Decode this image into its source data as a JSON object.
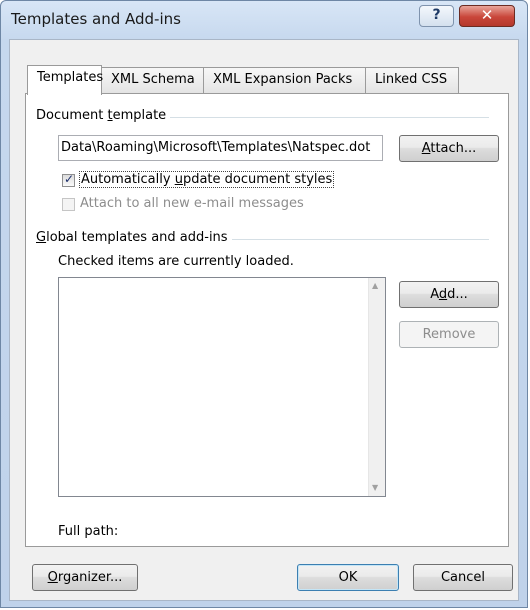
{
  "window": {
    "title": "Templates and Add-ins",
    "help_glyph": "?",
    "close_glyph": "✕"
  },
  "tabs": [
    {
      "label": "Templates",
      "active": true
    },
    {
      "label": "XML Schema",
      "active": false
    },
    {
      "label": "XML Expansion Packs",
      "active": false
    },
    {
      "label": "Linked CSS",
      "active": false
    }
  ],
  "document_template": {
    "group_label_pre": "Document ",
    "group_label_accel": "t",
    "group_label_post": "emplate",
    "path_value": "Data\\Roaming\\Microsoft\\Templates\\Natspec.dot",
    "attach_button": {
      "accel": "A",
      "rest": "ttach..."
    },
    "auto_update": {
      "pre": "Automatically ",
      "accel": "u",
      "post": "pdate document styles",
      "checked": true
    },
    "attach_email": {
      "label": "Attach to all new e-mail messages",
      "checked": false,
      "enabled": false
    }
  },
  "global_templates": {
    "group_label_accel": "G",
    "group_label_rest": "lobal templates and add-ins",
    "hint": "Checked items are currently loaded.",
    "items": [],
    "add_button": {
      "pre": "A",
      "accel": "d",
      "post": "d..."
    },
    "remove_button": "Remove",
    "full_path_label": "Full path:"
  },
  "footer": {
    "organizer_button": {
      "accel": "O",
      "rest": "rganizer..."
    },
    "ok_button": "OK",
    "cancel_button": "Cancel"
  },
  "colors": {
    "title_bar": "#c6d8ee",
    "close_button": "#c9463a",
    "client_bg": "#f0f0f0",
    "default_button_border": "#3c7fb1"
  }
}
